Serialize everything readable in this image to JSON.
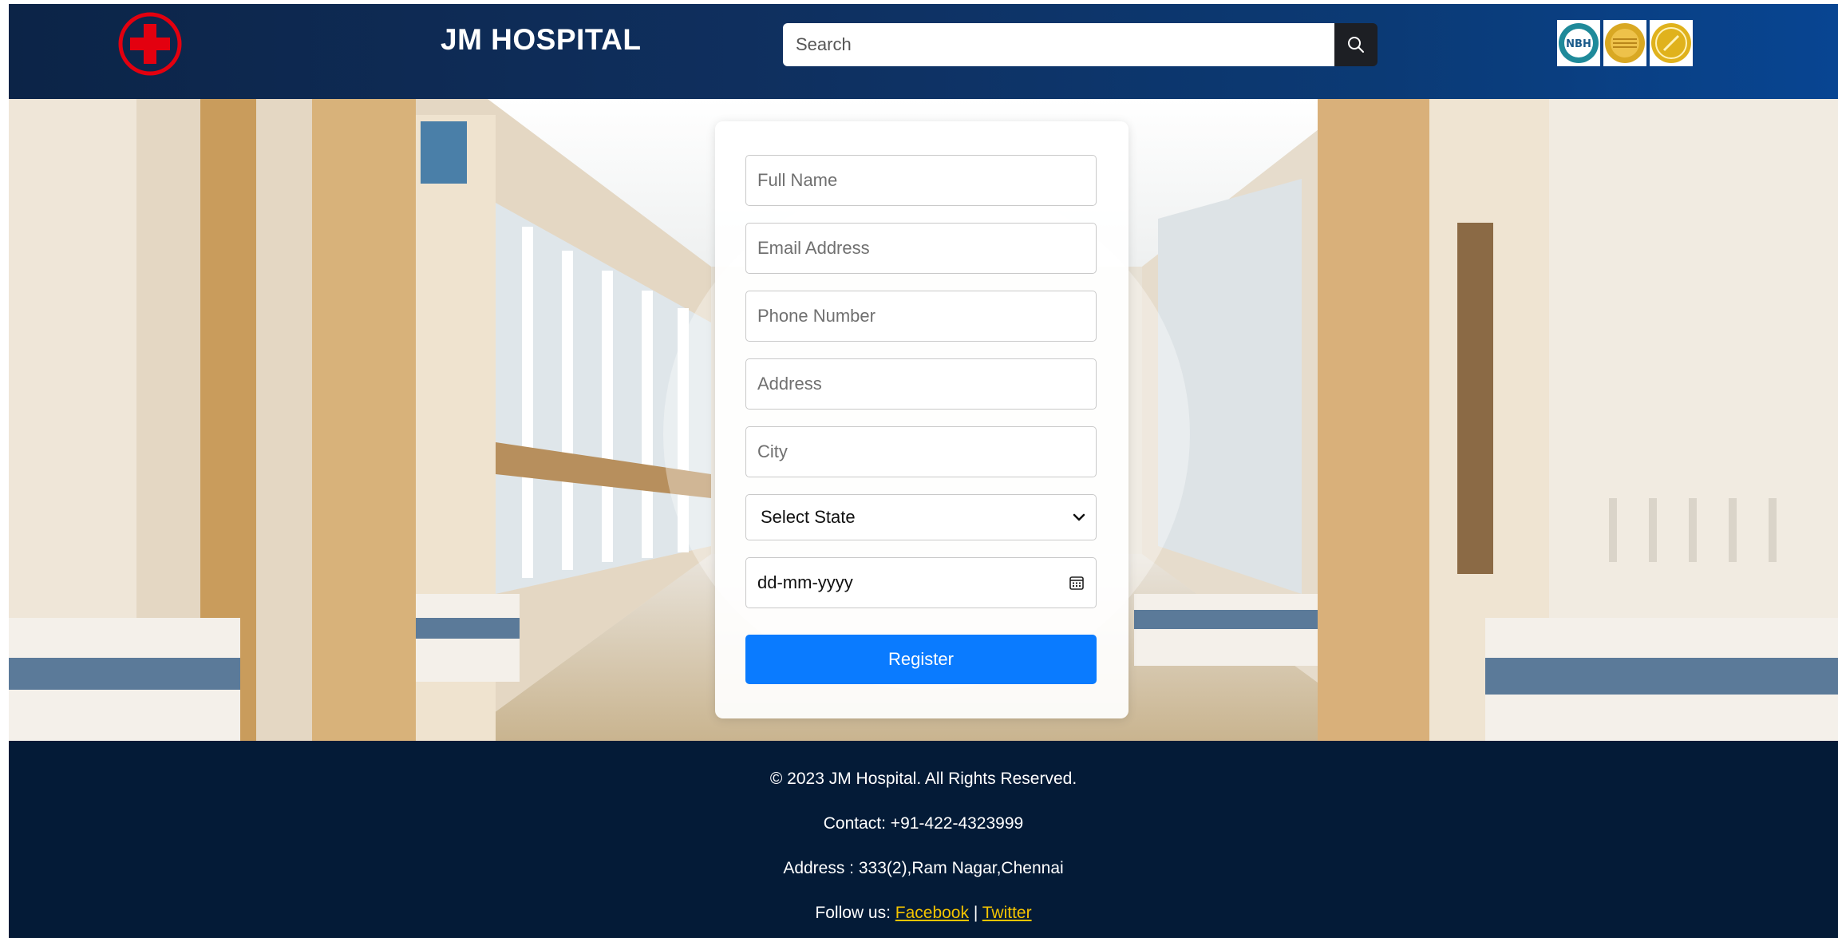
{
  "header": {
    "brand": "JM HOSPITAL",
    "search": {
      "placeholder": "Search"
    },
    "icons": {
      "logo": "red-cross-icon",
      "search": "magnifier-icon",
      "badges": [
        "nabh-badge",
        "gold-seal-badge",
        "gold-medal-badge"
      ]
    }
  },
  "form": {
    "full_name_placeholder": "Full Name",
    "email_placeholder": "Email Address",
    "phone_placeholder": "Phone Number",
    "address_placeholder": "Address",
    "city_placeholder": "City",
    "state_selected": "Select State",
    "date_placeholder": "dd-mm-yyyy",
    "register_label": "Register"
  },
  "footer": {
    "copyright": "© 2023 JM Hospital. All Rights Reserved.",
    "contact": "Contact: +91-422-4323999",
    "address": "Address : 333(2),Ram Nagar,Chennai",
    "follow_prefix": "Follow us: ",
    "facebook": "Facebook",
    "separator": " | ",
    "twitter": "Twitter"
  },
  "colors": {
    "header_bg": "#0f2f5e",
    "footer_bg": "#041b37",
    "accent": "#0a7bff",
    "link": "#f5c400",
    "logo_red": "#e3000f"
  }
}
